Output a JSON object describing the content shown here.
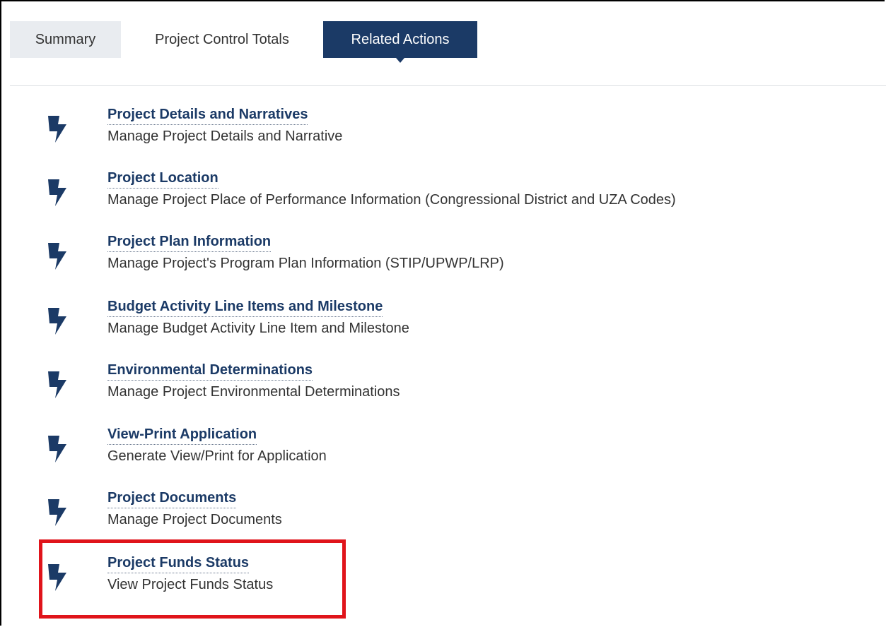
{
  "tabs": [
    {
      "label": "Summary"
    },
    {
      "label": "Project Control Totals"
    },
    {
      "label": "Related Actions"
    }
  ],
  "actions": [
    {
      "title": "Project Details and Narratives",
      "description": "Manage Project Details and Narrative",
      "icon": "lightning-bolt-icon"
    },
    {
      "title": "Project Location",
      "description": "Manage Project Place of Performance Information (Congressional District and UZA Codes)",
      "icon": "lightning-bolt-icon"
    },
    {
      "title": "Project Plan Information",
      "description": "Manage Project's Program Plan Information (STIP/UPWP/LRP)",
      "icon": "lightning-bolt-icon"
    },
    {
      "title": "Budget Activity Line Items and Milestone",
      "description": "Manage Budget Activity Line Item and Milestone",
      "icon": "lightning-bolt-icon"
    },
    {
      "title": "Environmental Determinations",
      "description": "Manage Project Environmental Determinations",
      "icon": "lightning-bolt-icon"
    },
    {
      "title": "View-Print Application",
      "description": "Generate View/Print for Application",
      "icon": "lightning-bolt-icon"
    },
    {
      "title": "Project Documents",
      "description": "Manage Project Documents",
      "icon": "lightning-bolt-icon"
    },
    {
      "title": "Project Funds Status",
      "description": "View Project Funds Status",
      "icon": "lightning-bolt-icon"
    }
  ],
  "colors": {
    "accent": "#1b3a66",
    "highlight": "#e0141b",
    "inactive_tab": "#e9ecf0"
  }
}
